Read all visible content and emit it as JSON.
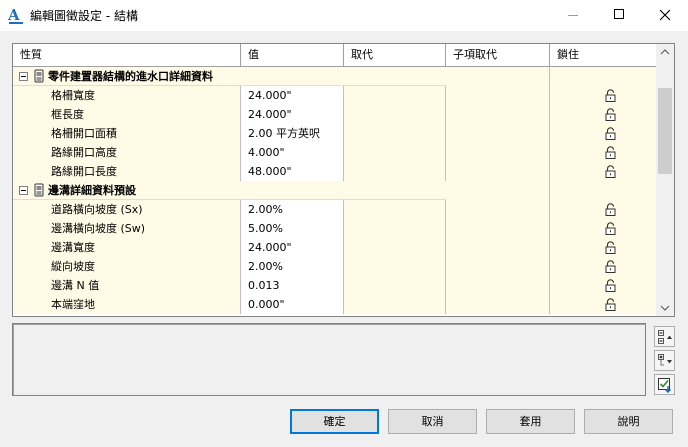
{
  "window": {
    "title": "編輯圖徵設定 - 結構",
    "app_icon_letter": "A"
  },
  "grid": {
    "headers": [
      "性質",
      "值",
      "取代",
      "子項取代",
      "鎖住"
    ],
    "categories": [
      {
        "label": "零件建置器結構的進水口詳細資料",
        "rows": [
          {
            "name": "格柵寬度",
            "value": "24.000\""
          },
          {
            "name": "框長度",
            "value": "24.000\""
          },
          {
            "name": "格柵開口面積",
            "value": "2.00 平方英呎"
          },
          {
            "name": "路緣開口高度",
            "value": "4.000\""
          },
          {
            "name": "路緣開口長度",
            "value": "48.000\""
          }
        ]
      },
      {
        "label": "邊溝詳細資料預設",
        "rows": [
          {
            "name": "道路橫向坡度 (Sx)",
            "value": "2.00%"
          },
          {
            "name": "邊溝橫向坡度 (Sw)",
            "value": "5.00%"
          },
          {
            "name": "邊溝寬度",
            "value": "24.000\""
          },
          {
            "name": "縱向坡度",
            "value": "2.00%"
          },
          {
            "name": "邊溝 N 值",
            "value": "0.013"
          },
          {
            "name": "本端窪地",
            "value": "0.000\""
          }
        ]
      }
    ]
  },
  "buttons": {
    "ok": "確定",
    "cancel": "取消",
    "apply": "套用",
    "help": "說明"
  },
  "colors": {
    "category_bg": "#fffbe6",
    "accent": "#0078d7",
    "grid_line": "#c8b9da"
  }
}
